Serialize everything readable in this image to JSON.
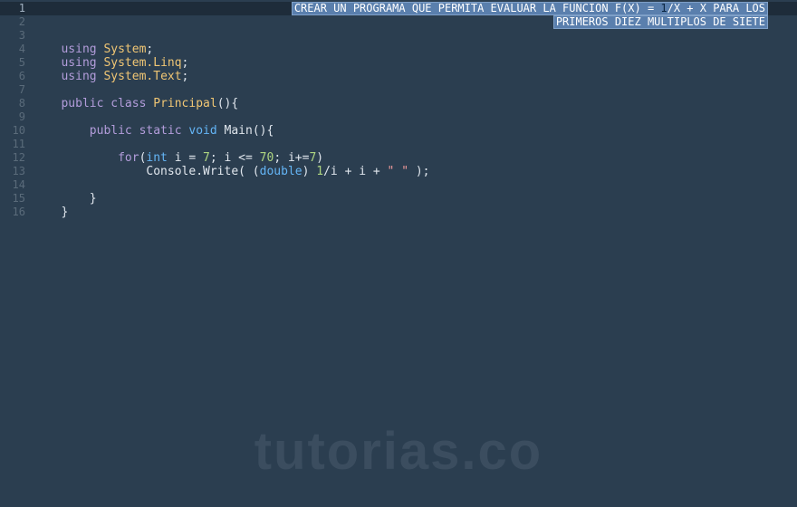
{
  "gutter": {
    "start": 1,
    "end": 16,
    "activeLine": 1
  },
  "selection": {
    "line1_a": "CREAR UN PROGRAMA QUE PERMITA EVALUAR LA FUNCION F(X) = ",
    "line1_num": "1",
    "line1_b": "/X + X PARA LOS",
    "line2": "PRIMEROS DIEZ MULTIPLOS DE SIETE"
  },
  "code": {
    "l4": {
      "kw": "using",
      "cls": "System",
      "p": ";"
    },
    "l5": {
      "kw": "using",
      "cls": "System.Linq",
      "p": ";"
    },
    "l6": {
      "kw": "using",
      "cls": "System.Text",
      "p": ";"
    },
    "l8": {
      "kw1": "public",
      "kw2": "class",
      "cls": "Principal",
      "rest": "(){"
    },
    "l10": {
      "kw1": "public",
      "kw2": "static",
      "type": "void",
      "name": "Main",
      "rest": "(){"
    },
    "l12": {
      "kw": "for",
      "p1": "(",
      "type": "int",
      "rest1": " i = ",
      "n1": "7",
      "rest2": "; i <= ",
      "n2": "70",
      "rest3": "; i+=",
      "n3": "7",
      "p2": ")"
    },
    "l13": {
      "a": "Console.Write( (",
      "type": "double",
      "b": ") ",
      "n": "1",
      "c": "/i + i + ",
      "str": "\" \"",
      "d": " );"
    },
    "l15": {
      "t": "}"
    },
    "l16": {
      "t": "}"
    }
  },
  "watermark": "tutorias.co"
}
